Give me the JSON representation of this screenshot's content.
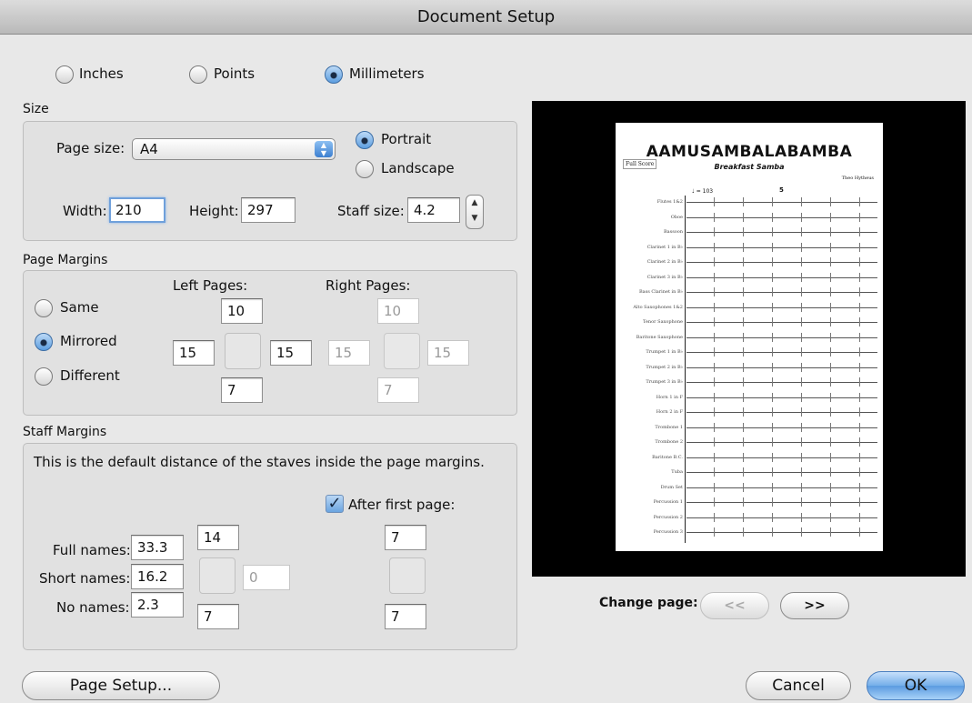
{
  "window": {
    "title": "Document Setup"
  },
  "units": {
    "inches": "Inches",
    "points": "Points",
    "millimeters": "Millimeters",
    "selected": "millimeters"
  },
  "size": {
    "heading": "Size",
    "page_size_label": "Page size:",
    "page_size_value": "A4",
    "portrait": "Portrait",
    "landscape": "Landscape",
    "orientation_selected": "portrait",
    "width_label": "Width:",
    "width_value": "210",
    "height_label": "Height:",
    "height_value": "297",
    "staff_size_label": "Staff size:",
    "staff_size_value": "4.2"
  },
  "page_margins": {
    "heading": "Page Margins",
    "same": "Same",
    "mirrored": "Mirrored",
    "different": "Different",
    "selected": "mirrored",
    "left_pages_label": "Left Pages:",
    "right_pages_label": "Right Pages:",
    "left": {
      "top": "10",
      "left": "15",
      "right": "15",
      "bottom": "7"
    },
    "right": {
      "top": "10",
      "left": "15",
      "right": "15",
      "bottom": "7"
    }
  },
  "staff_margins": {
    "heading": "Staff Margins",
    "description": "This is the default distance of the staves inside the page margins.",
    "after_first_page_label": "After first page:",
    "after_first_page_checked": true,
    "full_names_label": "Full names:",
    "full_names_value": "33.3",
    "short_names_label": "Short names:",
    "short_names_value": "16.2",
    "no_names_label": "No names:",
    "no_names_value": "2.3",
    "first_top": "14",
    "first_right": "0",
    "first_bottom": "7",
    "after_top": "7",
    "after_bottom": "7"
  },
  "preview": {
    "score_title": "AAMUSAMBALABAMBA",
    "score_subtitle": "Breakfast Samba",
    "full_score": "Full Score",
    "composer": "Theo Hytheus",
    "tempo": "♩ = 103",
    "rehearsal": "5",
    "instruments": [
      "Flutes 1&2",
      "Oboe",
      "Bassoon",
      "Clarinet 1 in B♭",
      "Clarinet 2 in B♭",
      "Clarinet 3 in B♭",
      "Bass Clarinet in B♭",
      "Alto Saxophones 1&2",
      "Tenor Saxophone",
      "Baritone Saxophone",
      "Trumpet 1 in B♭",
      "Trumpet 2 in B♭",
      "Trumpet 3 in B♭",
      "Horn 1 in F",
      "Horn 2 in F",
      "Trombone 1",
      "Trombone 2",
      "Baritone B.C.",
      "Tuba",
      "Drum Set",
      "Percussion 1",
      "Percussion 2",
      "Percussion 3"
    ]
  },
  "change_page": {
    "label": "Change page:",
    "prev": "<<",
    "next": ">>"
  },
  "buttons": {
    "page_setup": "Page Setup...",
    "cancel": "Cancel",
    "ok": "OK"
  }
}
